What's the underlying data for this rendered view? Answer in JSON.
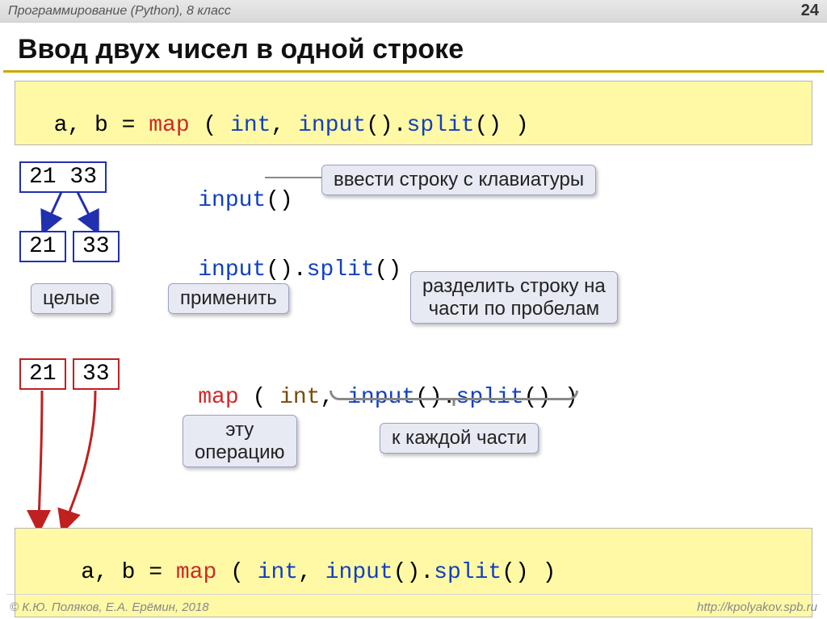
{
  "header": {
    "course": "Программирование (Python), 8 класс",
    "page_number": "24"
  },
  "title": "Ввод двух чисел в одной строке",
  "code_top": {
    "lhs": "a, b = ",
    "map": "map",
    "sp1": " ( ",
    "int": "int",
    "sep": ", ",
    "input": "input",
    "call1": "().",
    "split": "split",
    "call2": "()",
    "end": " )"
  },
  "row1": {
    "box": "21 33",
    "code_input": "input",
    "code_paren": "()",
    "callout": "ввести строку с клавиатуры"
  },
  "row2": {
    "box_a": "21",
    "box_b": "33",
    "code_input": "input",
    "code_p1": "().",
    "code_split": "split",
    "code_p2": "()",
    "callout_left": "целые",
    "callout_mid": "применить",
    "callout_right1": "разделить строку на",
    "callout_right2": "части по пробелам"
  },
  "row3": {
    "box_a": "21",
    "box_b": "33",
    "code_map": "map",
    "sp1": " ( ",
    "code_int": "int",
    "sep": ", ",
    "code_input": "input",
    "p1": "().",
    "code_split": "split",
    "p2": "()",
    "end": " )",
    "callout_op1": "эту",
    "callout_op2": "операцию",
    "callout_each": "к каждой части"
  },
  "code_bottom": {
    "lhs": "a, b = ",
    "map": "map",
    "sp1": " ( ",
    "int": "int",
    "sep": ", ",
    "input": "input",
    "call1": "().",
    "split": "split",
    "call2": "()",
    "end": " )"
  },
  "footer": {
    "left": "© К.Ю. Поляков, Е.А. Ерёмин, 2018",
    "right": "http://kpolyakov.spb.ru"
  }
}
